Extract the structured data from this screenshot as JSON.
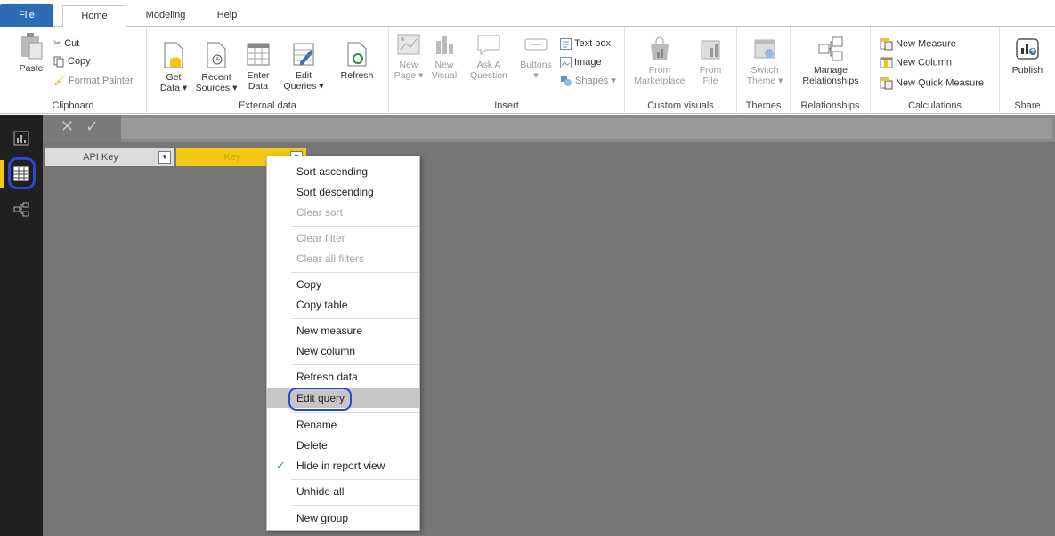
{
  "tabs": {
    "file": "File",
    "home": "Home",
    "modeling": "Modeling",
    "help": "Help"
  },
  "ribbon": {
    "clipboard": {
      "paste": "Paste",
      "cut": "Cut",
      "copy": "Copy",
      "format_painter": "Format Painter",
      "label": "Clipboard"
    },
    "external_data": {
      "get_data_1": "Get",
      "get_data_2": "Data ▾",
      "recent_sources_1": "Recent",
      "recent_sources_2": "Sources ▾",
      "enter_data_1": "Enter",
      "enter_data_2": "Data",
      "edit_queries_1": "Edit",
      "edit_queries_2": "Queries ▾",
      "refresh": "Refresh",
      "label": "External data"
    },
    "insert": {
      "new_page_1": "New",
      "new_page_2": "Page ▾",
      "new_visual_1": "New",
      "new_visual_2": "Visual",
      "ask_question_1": "Ask A",
      "ask_question_2": "Question",
      "buttons_1": "Buttons",
      "buttons_2": "▾",
      "text_box": "Text box",
      "image": "Image",
      "shapes": "Shapes ▾",
      "label": "Insert"
    },
    "custom_visuals": {
      "from_marketplace_1": "From",
      "from_marketplace_2": "Marketplace",
      "from_file_1": "From",
      "from_file_2": "File",
      "label": "Custom visuals"
    },
    "themes": {
      "switch_theme_1": "Switch",
      "switch_theme_2": "Theme ▾",
      "label": "Themes"
    },
    "relationships": {
      "manage_1": "Manage",
      "manage_2": "Relationships",
      "label": "Relationships"
    },
    "calculations": {
      "new_measure": "New Measure",
      "new_column": "New Column",
      "new_quick_measure": "New Quick Measure",
      "label": "Calculations"
    },
    "share": {
      "publish": "Publish",
      "label": "Share"
    }
  },
  "formula": {
    "cancel": "✕",
    "commit": "✓"
  },
  "columns": [
    {
      "label": "API Key"
    },
    {
      "label": "Key"
    }
  ],
  "context_menu": {
    "sort_ascending": "Sort ascending",
    "sort_descending": "Sort descending",
    "clear_sort": "Clear sort",
    "clear_filter": "Clear filter",
    "clear_all_filters": "Clear all filters",
    "copy": "Copy",
    "copy_table": "Copy table",
    "new_measure": "New measure",
    "new_column": "New column",
    "refresh_data": "Refresh data",
    "edit_query": "Edit query",
    "rename": "Rename",
    "delete": "Delete",
    "hide_in_report_view": "Hide in report view",
    "unhide_all": "Unhide all",
    "new_group": "New group"
  },
  "colors": {
    "accent": "#f2c811",
    "file_tab": "#2b6cb5",
    "highlight_ring": "#2a47d6",
    "check": "#2f9e44"
  }
}
